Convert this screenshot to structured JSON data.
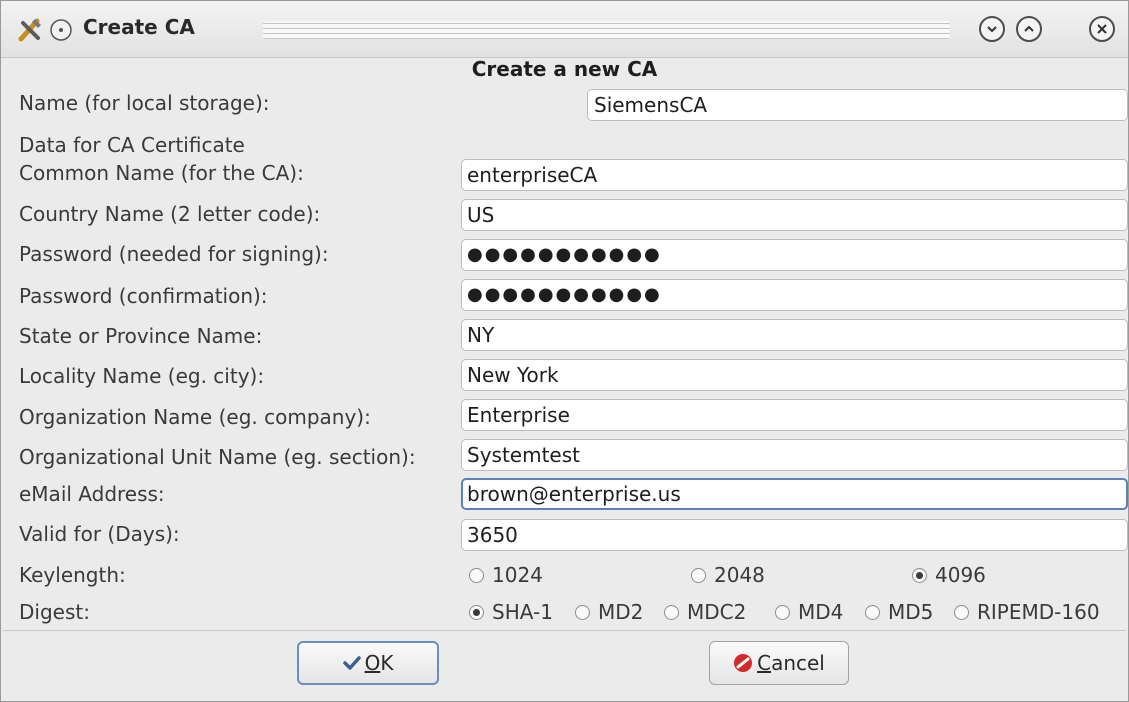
{
  "window": {
    "title": "Create CA",
    "app_icon": "tools-icon",
    "pin_icon": "circle-dot-icon",
    "buttons": [
      "minimize-icon",
      "maximize-icon",
      "close-icon"
    ]
  },
  "heading": "Create a new CA",
  "name_row": {
    "label": "Name (for local storage):",
    "value": "SiemensCA"
  },
  "section_label": "Data for CA Certificate",
  "fields": {
    "common_name": {
      "label": "Common Name (for the CA):",
      "value": "enterpriseCA"
    },
    "country": {
      "label": "Country Name (2 letter code):",
      "value": "US"
    },
    "password": {
      "label": "Password (needed for signing):",
      "value": "●●●●●●●●●●●"
    },
    "password_confirm": {
      "label": "Password (confirmation):",
      "value": "●●●●●●●●●●●"
    },
    "state": {
      "label": "State or Province Name:",
      "value": "NY"
    },
    "locality": {
      "label": "Locality Name (eg. city):",
      "value": "New York"
    },
    "organization": {
      "label": "Organization Name (eg. company):",
      "value": "Enterprise"
    },
    "org_unit": {
      "label": "Organizational Unit Name (eg. section):",
      "value": "Systemtest"
    },
    "email": {
      "label": "eMail Address:",
      "value": "brown@enterprise.us"
    },
    "valid_days": {
      "label": "Valid for (Days):",
      "value": "3650"
    }
  },
  "keylength": {
    "label": "Keylength:",
    "options": [
      "1024",
      "2048",
      "4096"
    ],
    "selected": "4096"
  },
  "digest": {
    "label": "Digest:",
    "options": [
      "SHA-1",
      "MD2",
      "MDC2",
      "MD4",
      "MD5",
      "RIPEMD-160"
    ],
    "selected": "SHA-1"
  },
  "buttons": {
    "ok": {
      "label_mnemonic": "O",
      "label_rest": "K",
      "icon": "checkmark-icon"
    },
    "cancel": {
      "label_mnemonic": "C",
      "label_rest": "ancel",
      "icon": "cancel-icon"
    }
  },
  "colors": {
    "focus_border": "#5b82b8",
    "cancel_icon": "#d22b2b",
    "ok_icon": "#3d5f8f"
  }
}
